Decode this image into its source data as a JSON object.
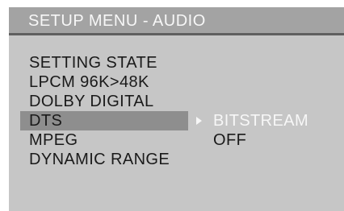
{
  "header": {
    "title": "SETUP MENU - AUDIO"
  },
  "menu": {
    "items": [
      {
        "label": "SETTING STATE",
        "value": ""
      },
      {
        "label": "LPCM 96K>48K",
        "value": ""
      },
      {
        "label": "DOLBY DIGITAL",
        "value": ""
      },
      {
        "label": "DTS",
        "value": "BITSTREAM",
        "selected": true
      },
      {
        "label": "MPEG",
        "value": "OFF"
      },
      {
        "label": "DYNAMIC RANGE",
        "value": ""
      }
    ]
  },
  "colors": {
    "screen_background": "#c6c6c6",
    "title_background": "#a3a3a3",
    "title_rule": "#5f5f5f",
    "selection_highlight": "#8e8e8e",
    "text_dark": "#1a1a1a",
    "text_light": "#f7f7f7"
  },
  "icons": {
    "selection_arrow": "triangle-right-icon"
  }
}
